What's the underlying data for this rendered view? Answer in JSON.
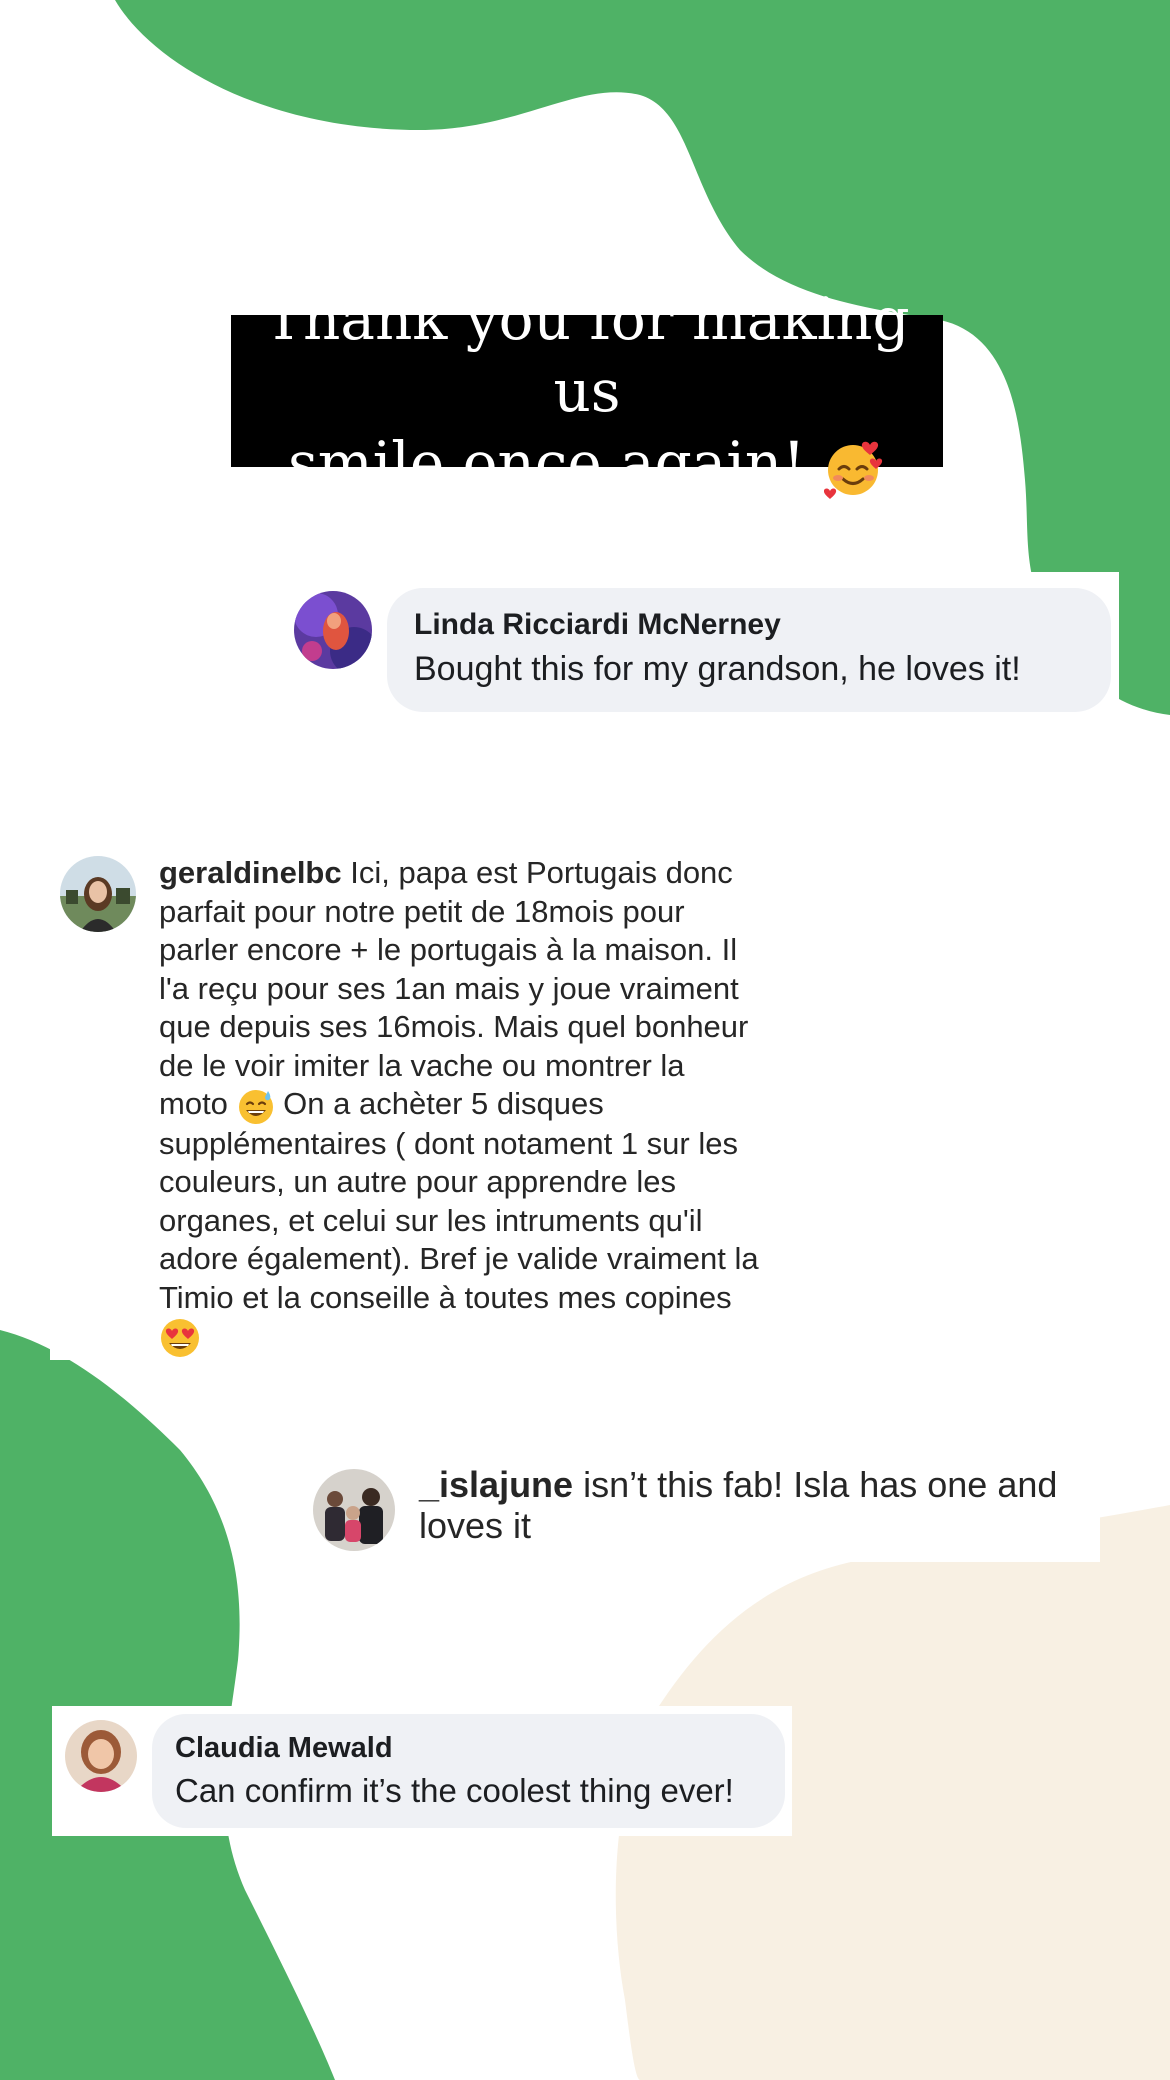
{
  "headline": {
    "line1": "Thank you for making us",
    "line2": "smile once again!",
    "emoji": "smiling-face-with-hearts"
  },
  "colors": {
    "green": "#4fb266",
    "cream": "#f8f0e3",
    "bubble": "#eff1f5"
  },
  "comments": [
    {
      "author": "Linda Ricciardi McNerney",
      "text": "Bought this for my grandson, he loves it!"
    },
    {
      "author": "geraldinelbc",
      "lines": [
        "Ici, papa est Portugais donc",
        "parfait pour notre petit de 18mois pour",
        "parler encore + le portugais à la maison. Il",
        "l'a reçu pour ses 1an mais y joue vraiment",
        "que depuis ses 16mois. Mais quel bonheur",
        "de le voir imiter la vache ou montrer la",
        "moto",
        "On a achèter 5 disques",
        "supplémentaires ( dont notament 1 sur les",
        "couleurs, un autre pour apprendre les",
        "organes, et celui sur les intruments qu'il",
        "adore également). Bref je valide vraiment la",
        "Timio et la conseille à toutes mes copines"
      ],
      "emojis": [
        "grinning-face-with-sweat",
        "heart-eyes"
      ]
    },
    {
      "author": "_islajune",
      "text": "isn’t this fab! Isla has one and",
      "text_line2": "loves it"
    },
    {
      "author": "Claudia Mewald",
      "text": "Can confirm it’s the coolest thing ever!"
    }
  ]
}
